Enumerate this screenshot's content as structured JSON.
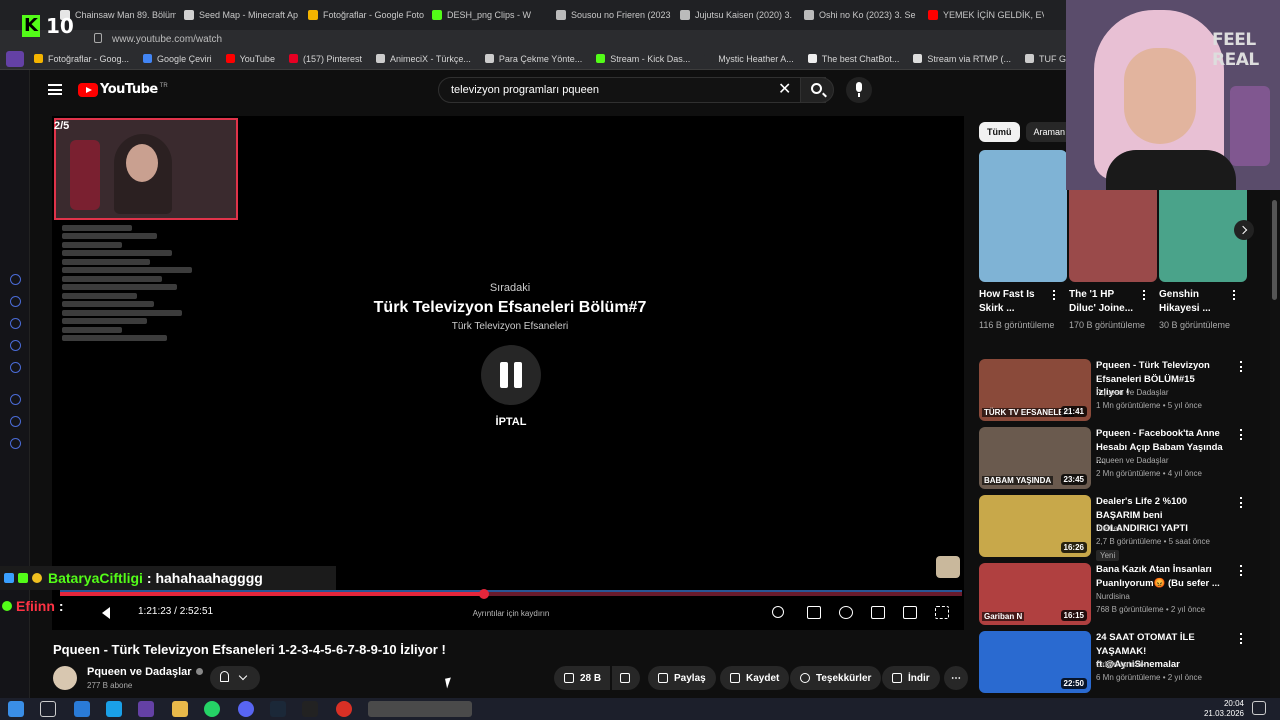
{
  "browser": {
    "kick_viewers": "10",
    "tabs": [
      {
        "label": "Chainsaw Man 89. Bölüm",
        "color": "#e6e6e6"
      },
      {
        "label": "Seed Map - Minecraft Ap",
        "color": "#d0d0d0"
      },
      {
        "label": "Fotoğraflar - Google Foto",
        "color": "#f4b400"
      },
      {
        "label": "DESH_png Clips - W",
        "color": "#53fc18"
      },
      {
        "label": "Sousou no Frieren (2023",
        "color": "#bbbbbb"
      },
      {
        "label": "Jujutsu Kaisen (2020) 3.",
        "color": "#bbbbbb"
      },
      {
        "label": "Oshi no Ko (2023) 3. Se",
        "color": "#bbbbbb"
      },
      {
        "label": "YEMEK İÇİN GELDİK, EV",
        "color": "#ff0000"
      }
    ],
    "url": "www.youtube.com/watch",
    "bookmarks": [
      {
        "label": "Fotoğraflar - Goog...",
        "color": "#f4b400"
      },
      {
        "label": "Google Çeviri",
        "color": "#4285f4"
      },
      {
        "label": "YouTube",
        "color": "#ff0000"
      },
      {
        "label": "(157) Pinterest",
        "color": "#e60023"
      },
      {
        "label": "AnimeciX - Türkçe...",
        "color": "#cccccc"
      },
      {
        "label": "Para Çekme Yönte...",
        "color": "#cccccc"
      },
      {
        "label": "Stream - Kick Das...",
        "color": "#53fc18"
      },
      {
        "label": "Mystic Heather A...",
        "color": "#2b2c2f"
      },
      {
        "label": "The best ChatBot...",
        "color": "#eeeeee"
      },
      {
        "label": "Stream via RTMP (...",
        "color": "#dddddd"
      },
      {
        "label": "TUF GAMING B66...",
        "color": "#cccccc"
      }
    ]
  },
  "header": {
    "logo_text": "YouTube",
    "logo_region": "TR",
    "search_value": "televizyon programları pqueen"
  },
  "player": {
    "playlist_position": "2/5",
    "up_next_label": "Sıradaki",
    "up_next_title": "Türk Televizyon Efsaneleri Bölüm#7",
    "up_next_channel": "Türk Televizyon Efsaneleri",
    "cancel_label": "İPTAL",
    "time_display": "1:21:23 / 2:52:51",
    "progress": 0.47,
    "details_hint": "Ayrıntılar için kaydırın"
  },
  "kick_chat": [
    {
      "user": "BataryaCiftligi",
      "message": ": hahahaahagggg"
    },
    {
      "user": "Efiinn",
      "message": ":"
    }
  ],
  "video": {
    "title": "Pqueen - Türk Televizyon Efsaneleri 1-2-3-4-5-6-7-8-9-10 İzliyor !",
    "channel": "Pqueen ve Dadaşlar",
    "subscribers": "277 B abone",
    "likes": "28 B",
    "share_label": "Paylaş",
    "save_label": "Kaydet",
    "thanks_label": "Teşekkürler",
    "download_label": "İndir"
  },
  "sidebar": {
    "chips": [
      "Tümü",
      "Araman"
    ],
    "shorts": [
      {
        "title": "How Fast Is Skirk ...",
        "views": "116 B görüntüleme",
        "color": "#7fb3d5"
      },
      {
        "title": "The '1 HP Diluc' Joine...",
        "views": "170 B görüntüleme",
        "color": "#9a4a4a"
      },
      {
        "title": "Genshin Hikayesi ...",
        "views": "30 B görüntüleme",
        "color": "#4aa38a"
      }
    ],
    "recommended": [
      {
        "title": "Pqueen - Türk Televizyon Efsaneleri BÖLÜM#15 İzliyor !",
        "channel": "Pqueen ve Dadaşlar",
        "meta": "1 Mn görüntüleme • 5 yıl önce",
        "duration": "21:41",
        "thumb_text": "TÜRK TV EFSANELERİ",
        "color": "#8a4a3a",
        "badge": ""
      },
      {
        "title": "Pqueen - Facebook'ta Anne Hesabı Açıp Babam Yaşında ...",
        "channel": "Pqueen ve Dadaşlar",
        "meta": "2 Mn görüntüleme • 4 yıl önce",
        "duration": "23:45",
        "thumb_text": "BABAM YAŞINDA",
        "color": "#6a5a4e",
        "badge": ""
      },
      {
        "title": "Dealer's Life 2 %100 BAŞARIM beni DOLANDIRICI YAPTI",
        "channel": "metflex",
        "meta": "2,7 B görüntüleme • 5 saat önce",
        "duration": "16:26",
        "thumb_text": "",
        "color": "#c8a84a",
        "badge": "Yeni"
      },
      {
        "title": "Bana Kazık Atan İnsanları Puanlıyorum😡 (Bu sefer ...",
        "channel": "Nurdisina",
        "meta": "768 B görüntüleme • 2 yıl önce",
        "duration": "16:15",
        "thumb_text": "Gariban N",
        "color": "#b04040",
        "badge": ""
      },
      {
        "title": "24 SAAT OTOMAT İLE YAŞAMAK! ft.@AyniSinemalar",
        "channel": "Orkun Işıtmak",
        "meta": "6 Mn görüntüleme • 2 yıl önce",
        "duration": "22:50",
        "thumb_text": "",
        "color": "#2a6ad0",
        "badge": ""
      }
    ]
  },
  "webcam": {
    "overlay_text": "FEEL REAL"
  },
  "taskbar": {
    "time": "20:04",
    "date": "21.03.2026"
  }
}
